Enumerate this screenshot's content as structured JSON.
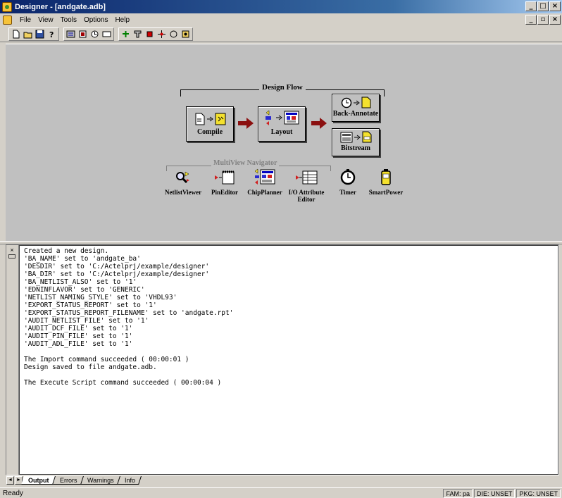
{
  "window": {
    "title": "Designer - [andgate.adb]",
    "minimize": "_",
    "maximize": "□",
    "close": "×",
    "mdi_minimize": "_",
    "mdi_restore": "▫",
    "mdi_close": "×"
  },
  "menu": {
    "items": [
      "File",
      "View",
      "Tools",
      "Options",
      "Help"
    ]
  },
  "toolbar": {
    "icons": [
      "new-icon",
      "open-icon",
      "save-icon",
      "help-icon",
      "netlist-icon",
      "pin-icon",
      "chip-icon",
      "io-icon",
      "timer-icon",
      "smartpower-icon",
      "tool-a-icon",
      "tool-b-icon",
      "tool-c-icon",
      "tool-d-icon"
    ]
  },
  "design_flow": {
    "title": "Design Flow",
    "steps": {
      "compile": "Compile",
      "layout": "Layout",
      "back_annotate": "Back-Annotate",
      "bitstream": "Bitstream"
    },
    "arrow_color": "#8b1010"
  },
  "multiview": {
    "title": "MultiView Navigator",
    "tools": {
      "netlist_viewer": "NetlistViewer",
      "pin_editor": "PinEditor",
      "chip_planner": "ChipPlanner",
      "io_editor_line1": "I/O Attribute",
      "io_editor_line2": "Editor",
      "timer": "Timer",
      "smartpower": "SmartPower"
    }
  },
  "log": {
    "lines": [
      "Created a new design.",
      "'BA_NAME' set to 'andgate_ba'",
      "'DESDIR' set to 'C:/Actelprj/example/designer'",
      "'BA_DIR' set to 'C:/Actelprj/example/designer'",
      "'BA_NETLIST_ALSO' set to '1'",
      "'EDNINFLAVOR' set to 'GENERIC'",
      "'NETLIST_NAMING_STYLE' set to 'VHDL93'",
      "'EXPORT_STATUS_REPORT' set to '1'",
      "'EXPORT_STATUS_REPORT_FILENAME' set to 'andgate.rpt'",
      "'AUDIT_NETLIST_FILE' set to '1'",
      "'AUDIT_DCF_FILE' set to '1'",
      "'AUDIT_PIN_FILE' set to '1'",
      "'AUDIT_ADL_FILE' set to '1'",
      "",
      "The Import command succeeded ( 00:00:01 )",
      "Design saved to file andgate.adb.",
      "",
      "The Execute Script command succeeded ( 00:00:04 )"
    ]
  },
  "tabs": {
    "items": [
      "Output",
      "Errors",
      "Warnings",
      "Info"
    ],
    "active": "Output",
    "scroll_left": "◄",
    "scroll_right": "►"
  },
  "status": {
    "ready": "Ready",
    "fam": "FAM: pa",
    "die": "DIE: UNSET",
    "pkg": "PKG: UNSET"
  }
}
